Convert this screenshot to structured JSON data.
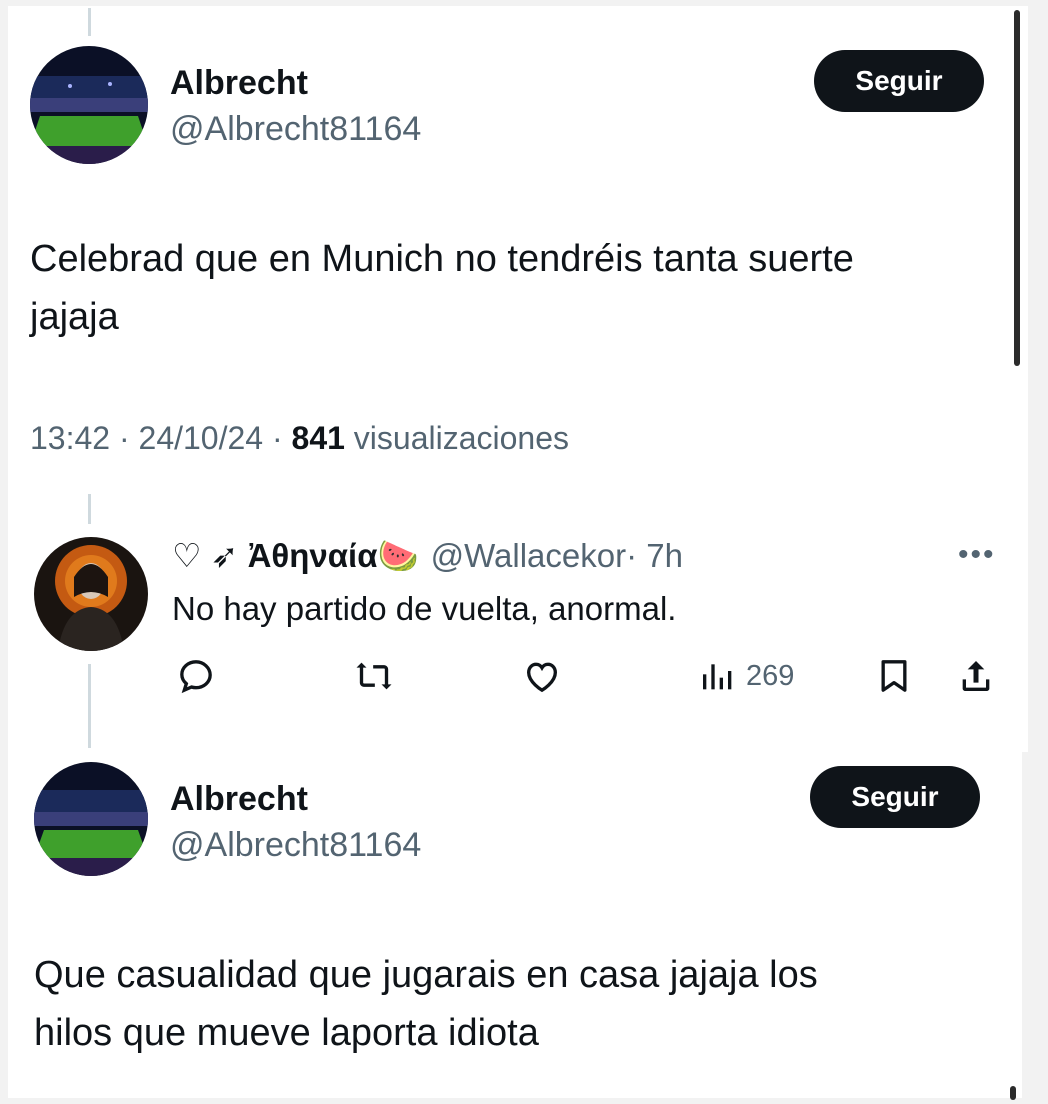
{
  "top_tweet": {
    "name": "Albrecht",
    "handle": "@Albrecht81164",
    "follow_label": "Seguir",
    "text_line1": "Celebrad que en Munich no tendréis tanta suerte",
    "text_line2": "jajaja",
    "time": "13:42 · 24/10/24 · ",
    "views_count": "841",
    "views_label": " visualizaciones"
  },
  "reply": {
    "name": "♡ ➶ Ἀθηναία🍉",
    "handle": "@Wallacekor",
    "time": " · 7h",
    "text": "No hay partido de vuelta, anormal.",
    "more_icon": "more-horizontal-icon",
    "views_count": "269",
    "actions": [
      "reply-icon",
      "retweet-icon",
      "like-icon",
      "views-icon",
      "bookmark-icon",
      "share-icon"
    ]
  },
  "bottom_tweet": {
    "name": "Albrecht",
    "handle": "@Albrecht81164",
    "follow_label": "Seguir",
    "text_line1": "Que casualidad que jugarais en casa jajaja los",
    "text_line2": "hilos que mueve laporta idiota"
  },
  "colors": {
    "text_primary": "#0f1419",
    "text_secondary": "#536471",
    "button_bg": "#0f1419",
    "thread_line": "#cfd9de"
  }
}
